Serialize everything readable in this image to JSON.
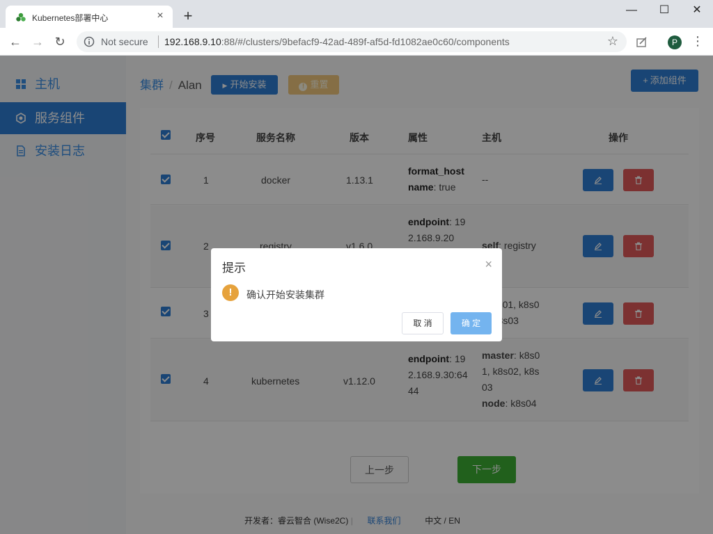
{
  "browser": {
    "tab_title": "Kubernetes部署中心",
    "tab_close": "×",
    "new_tab": "+",
    "security_label": "Not secure",
    "url_host": "192.168.9.10",
    "url_rest": ":88/#/clusters/9befacf9-42ad-489f-af5d-fd1082ae0c60/components",
    "profile_initial": "P",
    "minimize": "—",
    "maximize": "☐",
    "close": "✕"
  },
  "sidebar": {
    "items": [
      {
        "label": "主机",
        "icon": "grid-icon"
      },
      {
        "label": "服务组件",
        "icon": "component-icon"
      },
      {
        "label": "安装日志",
        "icon": "document-icon"
      }
    ]
  },
  "breadcrumb": {
    "parent": "集群",
    "separator": "/",
    "current": "Alan"
  },
  "toolbar": {
    "start_label": "开始安装",
    "reset_label": "重置",
    "add_label": "添加组件"
  },
  "table": {
    "headers": {
      "index": "序号",
      "name": "服务名称",
      "version": "版本",
      "attrs": "属性",
      "hosts": "主机",
      "actions": "操作"
    },
    "rows": [
      {
        "index": "1",
        "name": "docker",
        "version": "1.13.1",
        "attr_lines": [
          {
            "key": "format_host",
            "val": ""
          },
          {
            "key": "name",
            "val": ": true"
          }
        ],
        "host_lines": [
          {
            "key": "",
            "val": "--"
          }
        ]
      },
      {
        "index": "2",
        "name": "registry",
        "version": "v1.6.0",
        "attr_lines": [
          {
            "key": "endpoint",
            "val": ": 192.168.9.20"
          }
        ],
        "host_lines": [
          {
            "key": "self",
            "val": ": registry"
          }
        ]
      },
      {
        "index": "3",
        "name": "",
        "version": "",
        "attr_lines": [],
        "host_lines": [
          {
            "key": "",
            "val": ": k8s01, k8s02, k8s03"
          }
        ]
      },
      {
        "index": "4",
        "name": "kubernetes",
        "version": "v1.12.0",
        "attr_lines": [
          {
            "key": "endpoint",
            "val": ": 192.168.9.30:6444"
          }
        ],
        "host_lines": [
          {
            "key": "master",
            "val": ": k8s01, k8s02, k8s03"
          },
          {
            "key": "node",
            "val": ": k8s04"
          }
        ]
      }
    ]
  },
  "nav": {
    "prev": "上一步",
    "next": "下一步"
  },
  "footer": {
    "developer": "开发者：睿云智合 (Wise2C)",
    "divider": "|",
    "contact": "联系我们",
    "lang": "中文 / EN"
  },
  "dialog": {
    "title": "提示",
    "close": "×",
    "icon": "!",
    "message": "确认开始安装集群",
    "cancel": "取 消",
    "ok": "确 定"
  },
  "colors": {
    "primary": "#2f7fd6",
    "danger": "#e25a5a",
    "success": "#3cb034",
    "warning": "#e6a23c"
  }
}
